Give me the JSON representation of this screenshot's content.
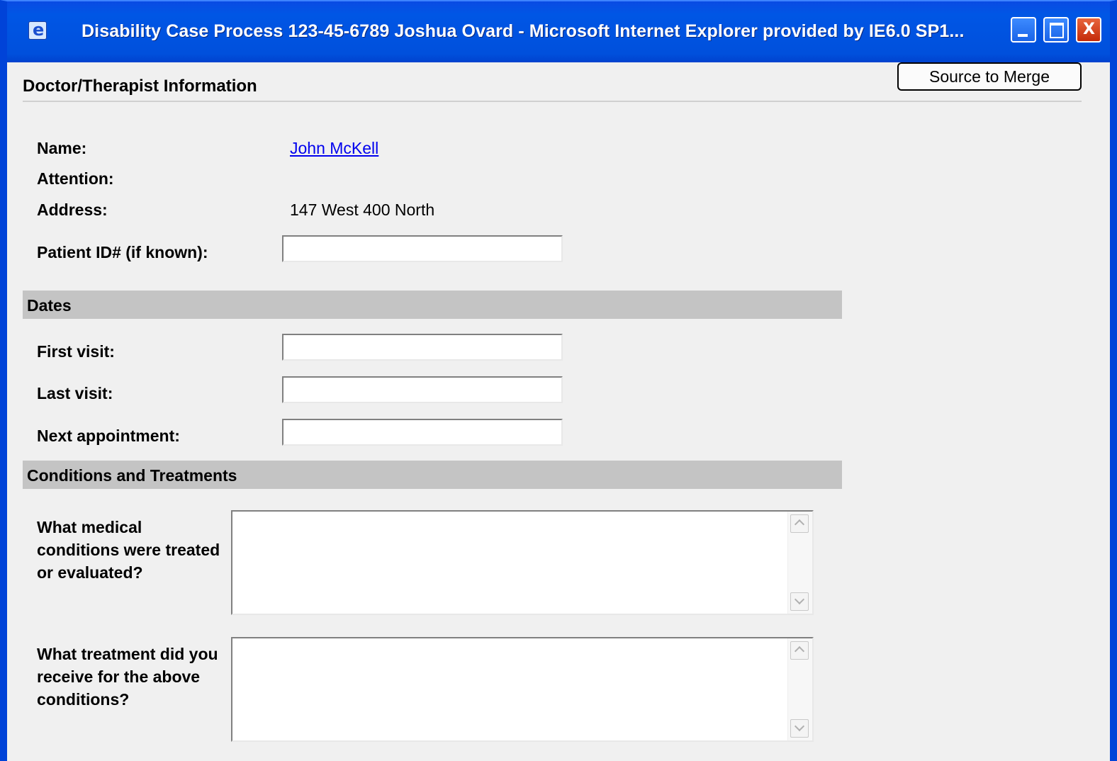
{
  "window": {
    "title": "Disability Case Process 123-45-6789 Joshua Ovard  -  Microsoft Internet Explorer provided by IE6.0 SP1...",
    "icon": "ie-icon",
    "controls": [
      "minimize-icon",
      "maximize-icon",
      "close-icon"
    ]
  },
  "header": {
    "title": "Doctor/Therapist Information",
    "source_button_label": "Source to Merge"
  },
  "provider": {
    "name_label": "Name:",
    "name_value": "John McKell",
    "attention_label": "Attention:",
    "attention_value": "",
    "address_label": "Address:",
    "address_value": "147 West 400 North",
    "patient_id_label": "Patient ID# (if known):",
    "patient_id_value": ""
  },
  "dates": {
    "heading": "Dates",
    "first_visit_label": "First visit:",
    "first_visit_value": "",
    "last_visit_label": "Last visit:",
    "last_visit_value": "",
    "next_appointment_label": "Next appointment:",
    "next_appointment_value": ""
  },
  "conditions": {
    "heading": "Conditions and Treatments",
    "conditions_question": "What medical conditions were treated or evaluated?",
    "conditions_value": "",
    "treatment_question": "What treatment did you receive for the above conditions?",
    "treatment_value": ""
  }
}
